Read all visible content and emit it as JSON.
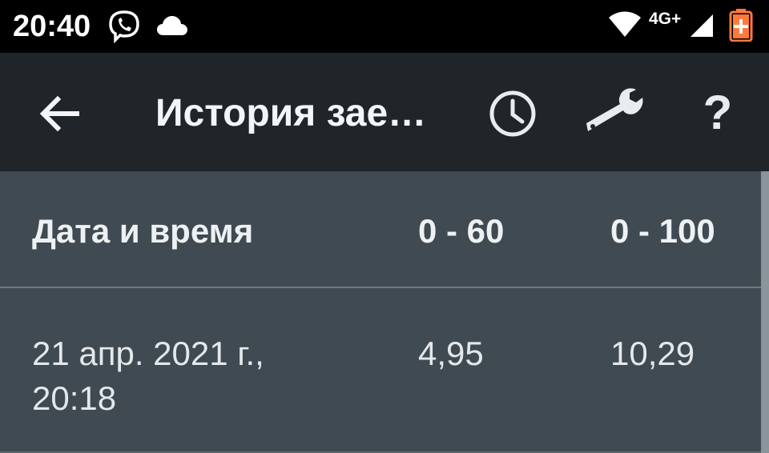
{
  "status_bar": {
    "time": "20:40",
    "network": "4G+",
    "icons": [
      "viber-icon",
      "cloud-icon",
      "wifi-icon",
      "signal-icon",
      "battery-charging-icon"
    ],
    "battery_color": "#ff7a3d"
  },
  "app_bar": {
    "title": "История зае…",
    "actions": [
      "clock-icon",
      "wrench-icon",
      "help-icon"
    ],
    "help_glyph": "?"
  },
  "table": {
    "columns": [
      "Дата и время",
      "0 - 60",
      "0 - 100"
    ],
    "rows": [
      {
        "date": "21 апр. 2021 г., 20:18",
        "v60": "4,95",
        "v100": "10,29"
      }
    ]
  },
  "colors": {
    "app_bar_bg": "#1f2529",
    "content_bg": "#3f4a52",
    "text": "#eef1f2"
  }
}
